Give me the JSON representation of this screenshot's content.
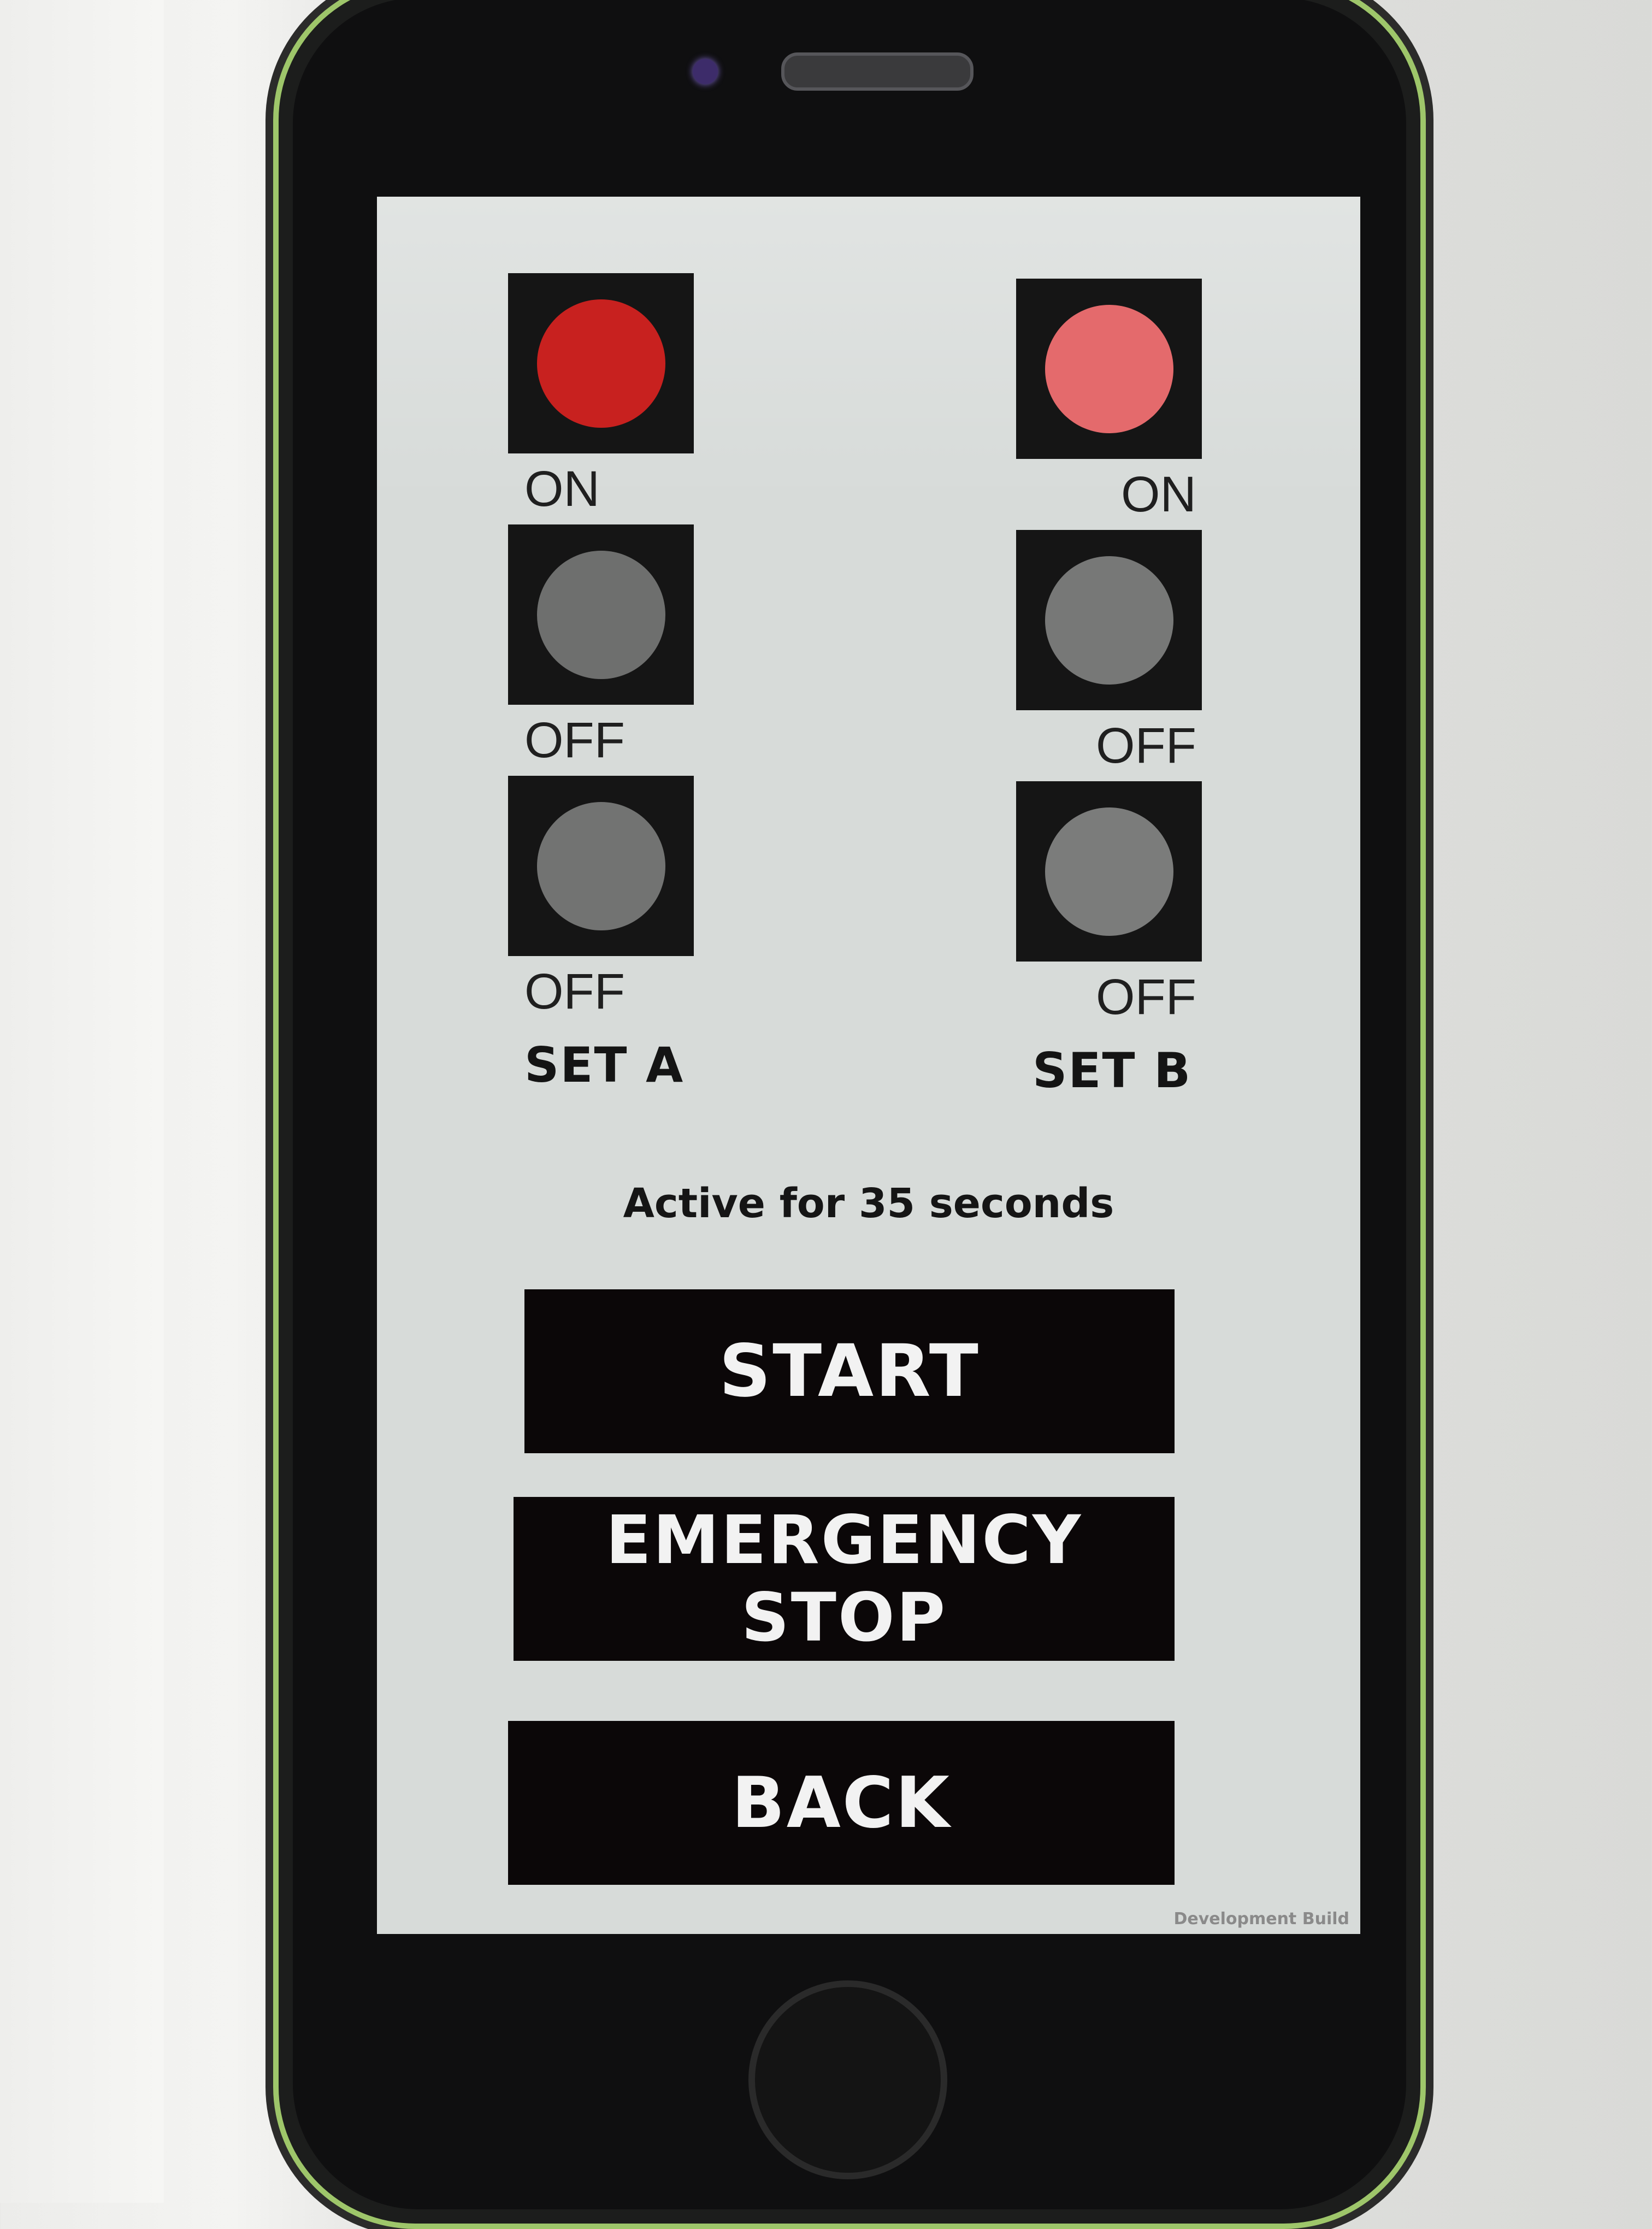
{
  "set_a": {
    "title": "SET A",
    "lights": [
      {
        "state": "ON",
        "color": "#c8211f"
      },
      {
        "state": "OFF",
        "color": "#6e6f6e"
      },
      {
        "state": "OFF",
        "color": "#727372"
      }
    ]
  },
  "set_b": {
    "title": "SET B",
    "lights": [
      {
        "state": "ON",
        "color": "#e46a6c"
      },
      {
        "state": "OFF",
        "color": "#777877"
      },
      {
        "state": "OFF",
        "color": "#7b7c7b"
      }
    ]
  },
  "status": {
    "active_text": "Active for 35 seconds"
  },
  "buttons": {
    "start_label": "START",
    "emergency_stop_label": "EMERGENCY STOP",
    "back_label": "BACK"
  },
  "footer": {
    "build_label": "Development Build"
  }
}
